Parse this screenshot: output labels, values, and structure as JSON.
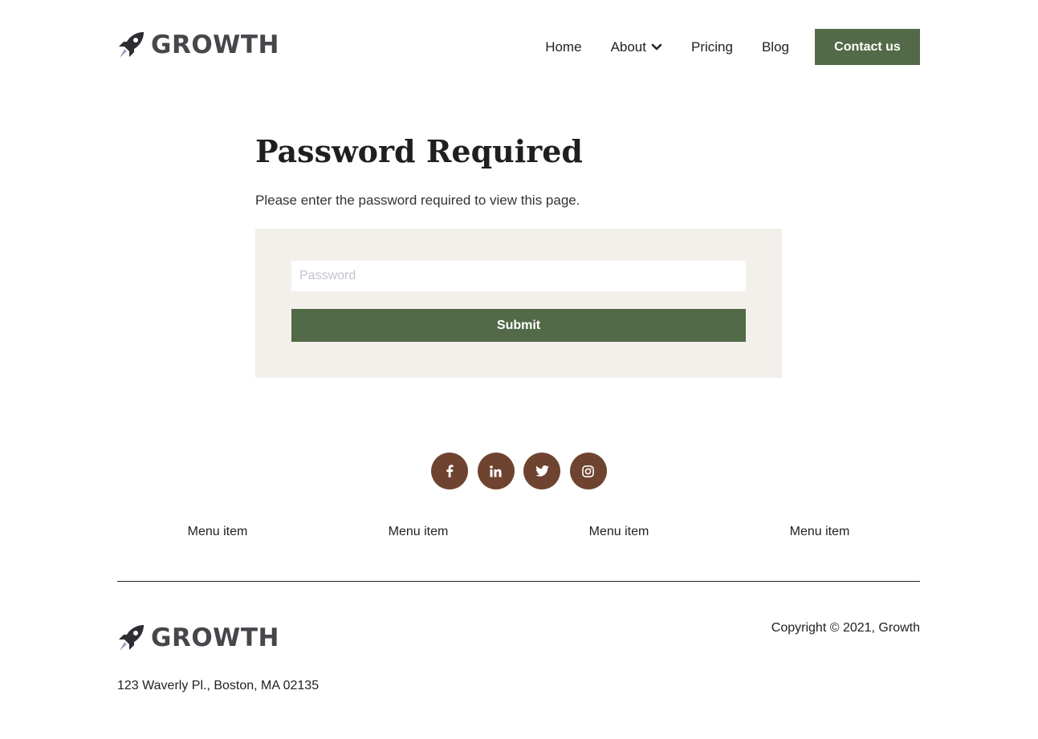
{
  "brand": {
    "name": "GROWTH",
    "color": "#46464b"
  },
  "nav": {
    "items": [
      {
        "label": "Home"
      },
      {
        "label": "About"
      },
      {
        "label": "Pricing"
      },
      {
        "label": "Blog"
      }
    ],
    "cta_label": "Contact us"
  },
  "main": {
    "title": "Password Required",
    "subtitle": "Please enter the password required to view this page.",
    "password_placeholder": "Password",
    "password_value": "",
    "submit_label": "Submit"
  },
  "social": {
    "icons": [
      "facebook-icon",
      "linkedin-icon",
      "twitter-icon",
      "instagram-icon"
    ]
  },
  "footer": {
    "menu": [
      {
        "label": "Menu item"
      },
      {
        "label": "Menu item"
      },
      {
        "label": "Menu item"
      },
      {
        "label": "Menu item"
      }
    ],
    "copyright": "Copyright © 2021, Growth",
    "address": "123 Waverly Pl., Boston, MA 02135"
  },
  "colors": {
    "accent": "#536a48",
    "social": "#6e4431",
    "card_bg": "#f3f0eb"
  }
}
